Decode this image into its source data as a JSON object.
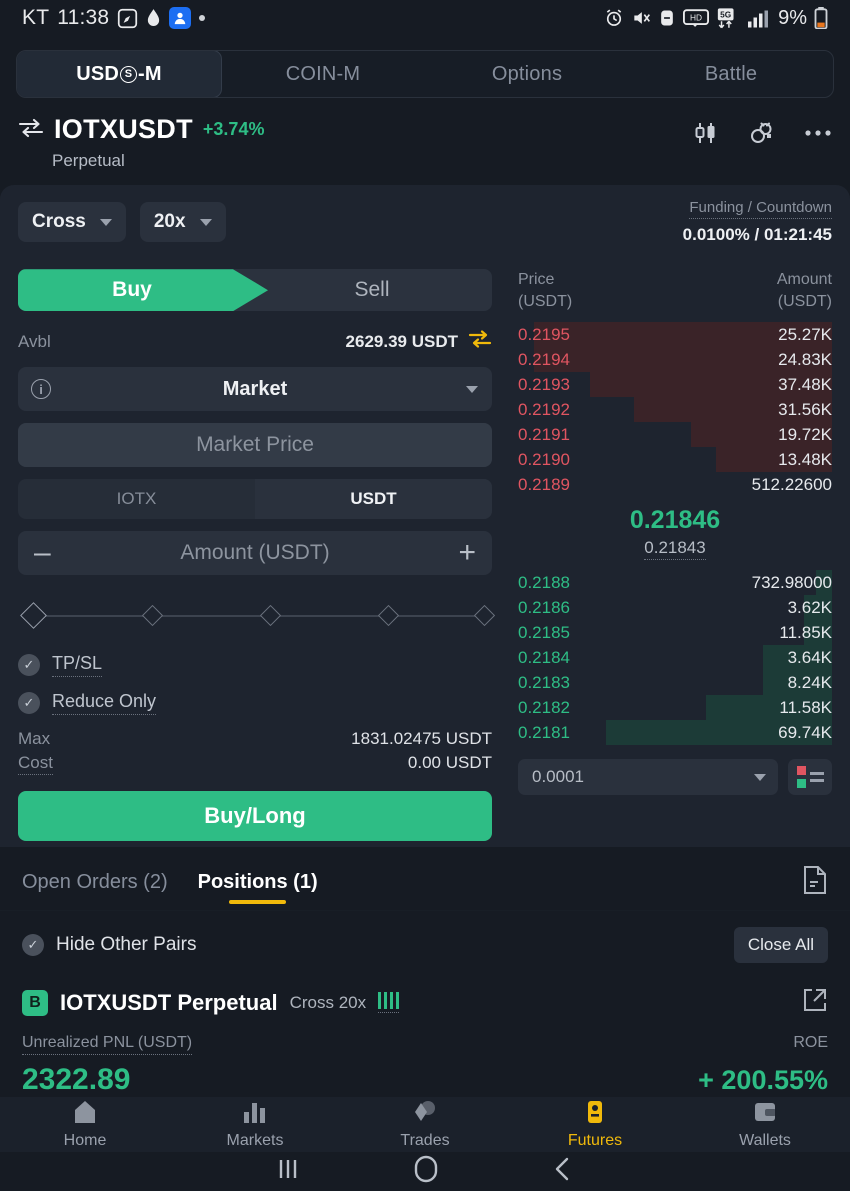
{
  "status_bar": {
    "carrier": "KT",
    "time": "11:38",
    "battery_percent": "9%",
    "left_icons": [
      "compass-icon",
      "water-drop-icon",
      "app-icon",
      "dot-icon"
    ],
    "right_icons": [
      "alarm-icon",
      "mute-icon",
      "dnd-icon",
      "hd-icon",
      "5g-icon",
      "signal-icon",
      "battery-icon"
    ]
  },
  "top_tabs": {
    "items": [
      {
        "label": "USDⓈ-M",
        "label_prefix": "USD",
        "label_circle": "S",
        "label_suffix": "-M",
        "active": true
      },
      {
        "label": "COIN-M",
        "active": false
      },
      {
        "label": "Options",
        "active": false
      },
      {
        "label": "Battle",
        "active": false
      }
    ]
  },
  "symbol_header": {
    "name": "IOTXUSDT",
    "change": "+3.74%",
    "subtitle": "Perpetual",
    "actions": [
      "candlestick-chart-icon",
      "trading-bot-icon",
      "more-options-icon"
    ]
  },
  "leverage_bar": {
    "margin_mode": "Cross",
    "leverage": "20x",
    "funding_label": "Funding / Countdown",
    "funding_value": "0.0100% / 01:21:45"
  },
  "order_form": {
    "buy_label": "Buy",
    "sell_label": "Sell",
    "avbl_label": "Avbl",
    "avbl_value": "2629.39 USDT",
    "order_type": "Market",
    "price_placeholder": "Market Price",
    "unit_base": "IOTX",
    "unit_quote": "USDT",
    "amount_placeholder": "Amount (USDT)",
    "minus": "–",
    "plus": "+",
    "tpsl_label": "TP/SL",
    "reduce_only_label": "Reduce Only",
    "max_label": "Max",
    "max_value": "1831.02475 USDT",
    "cost_label": "Cost",
    "cost_value": "0.00 USDT",
    "submit_label": "Buy/Long"
  },
  "order_book": {
    "price_header": "Price",
    "price_unit": "(USDT)",
    "amount_header": "Amount",
    "amount_unit": "(USDT)",
    "mid_price": "0.21846",
    "mark_price": "0.21843",
    "tick_size": "0.0001",
    "asks": [
      {
        "price": "0.2195",
        "amount": "25.27K",
        "depth": 95
      },
      {
        "price": "0.2194",
        "amount": "24.83K",
        "depth": 95
      },
      {
        "price": "0.2193",
        "amount": "37.48K",
        "depth": 77
      },
      {
        "price": "0.2192",
        "amount": "31.56K",
        "depth": 63
      },
      {
        "price": "0.2191",
        "amount": "19.72K",
        "depth": 45
      },
      {
        "price": "0.2190",
        "amount": "13.48K",
        "depth": 37
      },
      {
        "price": "0.2189",
        "amount": "512.22600",
        "depth": 0
      }
    ],
    "bids": [
      {
        "price": "0.2188",
        "amount": "732.98000",
        "depth": 5
      },
      {
        "price": "0.2186",
        "amount": "3.62K",
        "depth": 9
      },
      {
        "price": "0.2185",
        "amount": "11.85K",
        "depth": 9
      },
      {
        "price": "0.2184",
        "amount": "3.64K",
        "depth": 22
      },
      {
        "price": "0.2183",
        "amount": "8.24K",
        "depth": 22
      },
      {
        "price": "0.2182",
        "amount": "11.58K",
        "depth": 40
      },
      {
        "price": "0.2181",
        "amount": "69.74K",
        "depth": 72
      }
    ]
  },
  "orders_panel": {
    "tabs": [
      {
        "label": "Open Orders (2)",
        "active": false
      },
      {
        "label": "Positions (1)",
        "active": true
      }
    ],
    "doc_icon": "order-history-icon",
    "hide_other_pairs": "Hide Other Pairs",
    "close_all": "Close All"
  },
  "position": {
    "side_badge": "B",
    "symbol": "IOTXUSDT Perpetual",
    "margin": "Cross 20x",
    "pnl_label": "Unrealized PNL (USDT)",
    "roe_label": "ROE",
    "pnl_value": "2322.89",
    "roe_value": "+ 200.55%"
  },
  "bottom_nav": {
    "items": [
      {
        "label": "Home",
        "icon": "home-icon",
        "active": false
      },
      {
        "label": "Markets",
        "icon": "markets-icon",
        "active": false
      },
      {
        "label": "Trades",
        "icon": "trades-icon",
        "active": false
      },
      {
        "label": "Futures",
        "icon": "futures-icon",
        "active": true
      },
      {
        "label": "Wallets",
        "icon": "wallets-icon",
        "active": false
      }
    ]
  },
  "system_nav": [
    "recents-icon",
    "home-circle-icon",
    "back-icon"
  ],
  "colors": {
    "green": "#2ebd85",
    "red": "#e05561",
    "accent_yellow": "#f0b90b",
    "bg": "#161b23",
    "card": "#1e242f"
  }
}
